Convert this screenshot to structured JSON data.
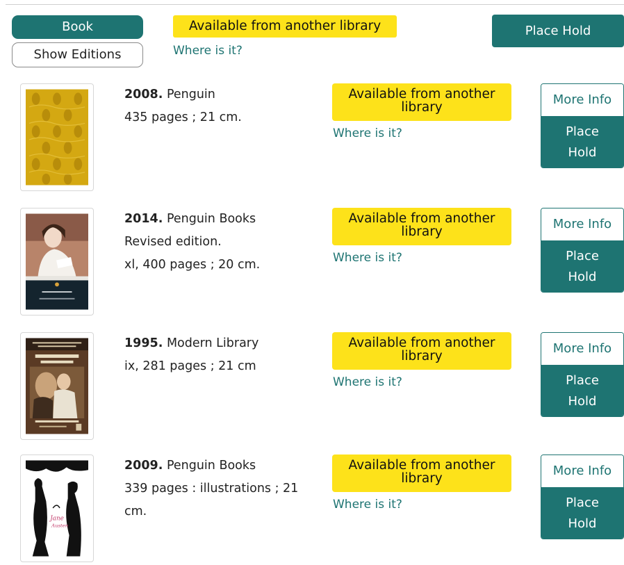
{
  "header": {
    "format_button": "Book",
    "show_editions_button": "Show Editions",
    "availability_badge": "Available from another library",
    "where_link": "Where is it?",
    "place_hold_button": "Place Hold"
  },
  "colors": {
    "accent_teal": "#1e7472",
    "availability_yellow": "#fde21a"
  },
  "editions": [
    {
      "year": "2008.",
      "publisher": "Penguin",
      "details": [
        "435 pages ; 21 cm."
      ],
      "availability": "Available from another library",
      "where_link": "Where is it?",
      "more_info": "More Info",
      "place_hold": "Place Hold"
    },
    {
      "year": "2014.",
      "publisher": "Penguin Books",
      "details": [
        "Revised edition.",
        "xl, 400 pages ; 20 cm."
      ],
      "availability": "Available from another library",
      "where_link": "Where is it?",
      "more_info": "More Info",
      "place_hold": "Place Hold"
    },
    {
      "year": "1995.",
      "publisher": "Modern Library",
      "details": [
        "ix, 281 pages ; 21 cm"
      ],
      "availability": "Available from another library",
      "where_link": "Where is it?",
      "more_info": "More Info",
      "place_hold": "Place Hold"
    },
    {
      "year": "2009.",
      "publisher": "Penguin Books",
      "details": [
        "339 pages : illustrations ; 21 cm."
      ],
      "availability": "Available from another library",
      "where_link": "Where is it?",
      "more_info": "More Info",
      "place_hold": "Place Hold"
    }
  ]
}
